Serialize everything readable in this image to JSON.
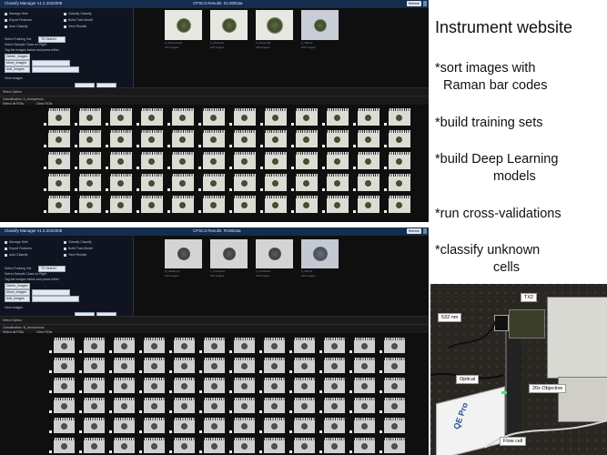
{
  "screenshot_top": {
    "app_title": "Classify Manager v1.2.2022008",
    "dataset_title": "CPSC3 Results: 01:00Data",
    "top_button": "Refresh",
    "menu": [
      "Manage Sets",
      "Export Features",
      "Auto Classify",
      "Classify Classify",
      "Build Train Model",
      "View Results"
    ],
    "controls": {
      "select_training": "Select Training Set",
      "select_value": "TS Select1",
      "sample_class": "Select Sample Class on Right",
      "tag_images": "Tag the images below and press either",
      "delete_images": "Delete_images",
      "move_images": "Move_Images",
      "add_images": "Add_Images",
      "view_images": "View Images",
      "thumbnail_size": "Thumbnail Size",
      "thumb_value": "Normal",
      "select_option": "Select Option",
      "classification": "Classification: 0_Anonymous",
      "select_all": "Select all ROIs",
      "clear": "Clear ROIs"
    },
    "reference_classes": [
      {
        "name": "0_Anonymous",
        "count": "100 images"
      },
      {
        "name": "1_Anomaly",
        "count": "100 images"
      },
      {
        "name": "2_Abnormal",
        "count": "100 images"
      },
      {
        "name": "3_Others",
        "count": "100 images"
      }
    ]
  },
  "screenshot_bottom": {
    "app_title": "Classify Manager v1.2.2022008",
    "dataset_title": "CPSC3 Results: RABData",
    "top_button": "Refresh",
    "menu": [
      "Manage Sets",
      "Export Features",
      "Auto Classify",
      "Classify Classify",
      "Build Train Model",
      "View Results"
    ],
    "controls": {
      "select_training": "Select Training Set",
      "select_value": "TS Select1",
      "sample_class": "Select Sample Class on Right",
      "tag_images": "Tag the images below and press either",
      "delete_images": "Delete_Images",
      "move_images": "Move_Images",
      "add_images": "Add_Images",
      "view_images": "View Images",
      "thumbnail_size": "Thumbnail Size",
      "thumb_value": "Normal",
      "select_option": "Select Option",
      "classification": "Classification: B_Anonymous",
      "select_all": "Select all ROIs",
      "clear": "Clear ROIs"
    },
    "reference_classes": [
      {
        "name": "0_Healthyxx",
        "count": "100 images"
      },
      {
        "name": "1_Inexistent",
        "count": "100 images"
      },
      {
        "name": "2_Inexistent",
        "count": "100 images"
      },
      {
        "name": "3_Others",
        "count": "100 images"
      }
    ]
  },
  "slide": {
    "title": "Instrument website",
    "bullets": [
      {
        "line1": "*sort images with",
        "line2": "Raman bar codes"
      },
      {
        "line1": "*build training sets",
        "line2": ""
      },
      {
        "line1": "*build Deep Learning",
        "line2": "models"
      },
      {
        "line1": "*run cross-validations",
        "line2": ""
      },
      {
        "line1": "*classify unknown",
        "line2": "cells"
      }
    ]
  },
  "photo_labels": {
    "tx2": "TX2",
    "laser": "532 nm",
    "optical": "Optical",
    "objective": "20x Objective",
    "flowcell": "Flow cell",
    "spectrometer": "QE Pro"
  }
}
